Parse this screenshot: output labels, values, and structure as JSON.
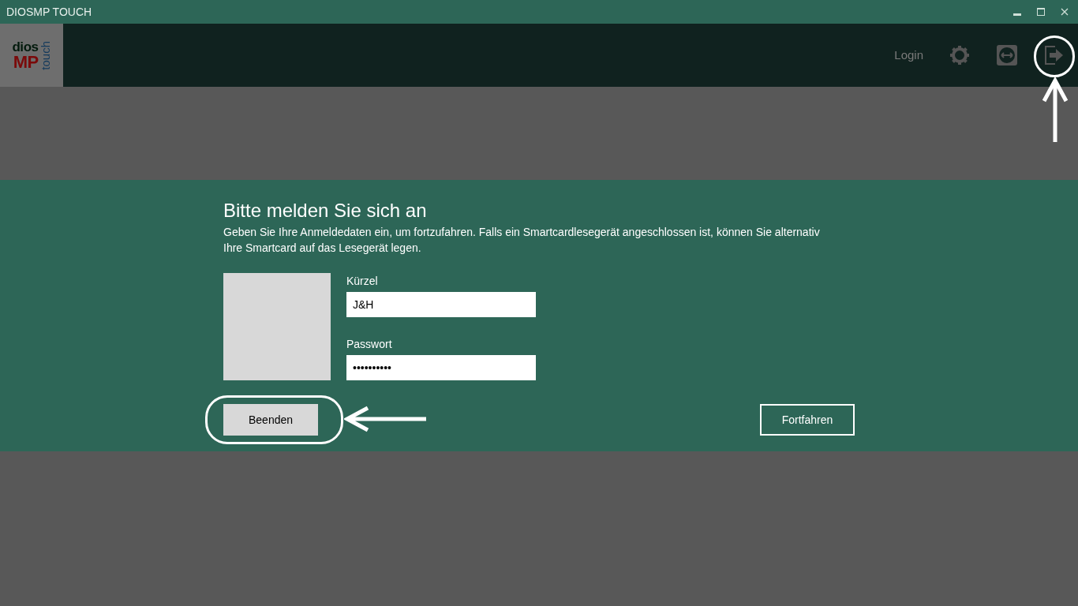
{
  "window": {
    "title": "DIOSMP TOUCH"
  },
  "logo": {
    "line_1": "dios",
    "line_2": "MP",
    "side": "touch"
  },
  "header": {
    "login_label": "Login"
  },
  "login": {
    "title": "Bitte melden Sie sich an",
    "description": "Geben Sie Ihre Anmeldedaten ein, um fortzufahren. Falls ein Smartcardlesegerät angeschlossen ist, können Sie alternativ Ihre Smartcard auf das Lesegerät legen.",
    "fields": [
      {
        "label": "Kürzel",
        "value": "J&H"
      },
      {
        "label": "Passwort",
        "value": "••••••••••"
      }
    ],
    "buttons": [
      {
        "label": "Beenden",
        "kind": "filled"
      },
      {
        "label": "Fortfahren",
        "kind": "outline"
      }
    ]
  }
}
